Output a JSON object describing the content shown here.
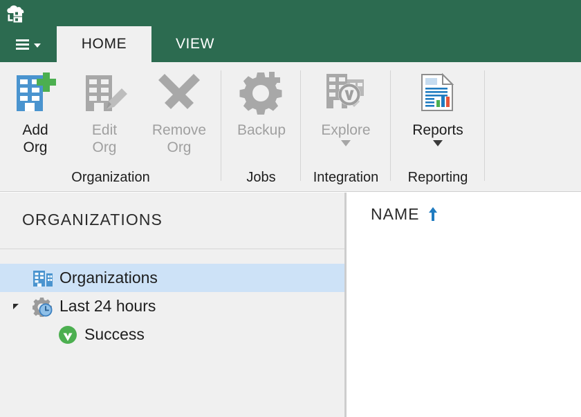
{
  "window": {
    "app_icon": "cloud-server-icon",
    "accent_green": "#2c6b50",
    "selection_blue": "#cde2f7",
    "panel_gray": "#f0f0f0"
  },
  "menu": {
    "icon": "hamburger-icon",
    "caret": "chevron-down-icon"
  },
  "tabs": [
    {
      "label": "HOME",
      "active": true
    },
    {
      "label": "VIEW",
      "active": false
    }
  ],
  "ribbon": {
    "groups": [
      {
        "title": "Organization",
        "buttons": [
          {
            "label": "Add\nOrg",
            "icon": "add-org-icon",
            "enabled": true,
            "dropdown": false
          },
          {
            "label": "Edit\nOrg",
            "icon": "edit-org-icon",
            "enabled": false,
            "dropdown": false
          },
          {
            "label": "Remove\nOrg",
            "icon": "remove-org-icon",
            "enabled": false,
            "dropdown": false
          }
        ]
      },
      {
        "title": "Jobs",
        "buttons": [
          {
            "label": "Backup",
            "icon": "backup-gear-icon",
            "enabled": false,
            "dropdown": false
          }
        ]
      },
      {
        "title": "Integration",
        "buttons": [
          {
            "label": "Explore",
            "icon": "explore-veeam-icon",
            "enabled": false,
            "dropdown": true
          }
        ]
      },
      {
        "title": "Reporting",
        "buttons": [
          {
            "label": "Reports",
            "icon": "reports-document-icon",
            "enabled": true,
            "dropdown": true
          }
        ]
      }
    ]
  },
  "sidebar": {
    "title": "ORGANIZATIONS",
    "tree": [
      {
        "label": "Organizations",
        "icon": "organizations-building-icon",
        "level": 1,
        "selected": true,
        "expander": false
      },
      {
        "label": "Last 24 hours",
        "icon": "gear-clock-icon",
        "level": 1,
        "selected": false,
        "expander": true
      },
      {
        "label": "Success",
        "icon": "success-check-icon",
        "level": 2,
        "selected": false,
        "expander": false
      }
    ]
  },
  "content": {
    "columns": [
      {
        "label": "NAME",
        "sort": "ascending",
        "sort_icon": "arrow-up-icon"
      }
    ],
    "rows": []
  }
}
